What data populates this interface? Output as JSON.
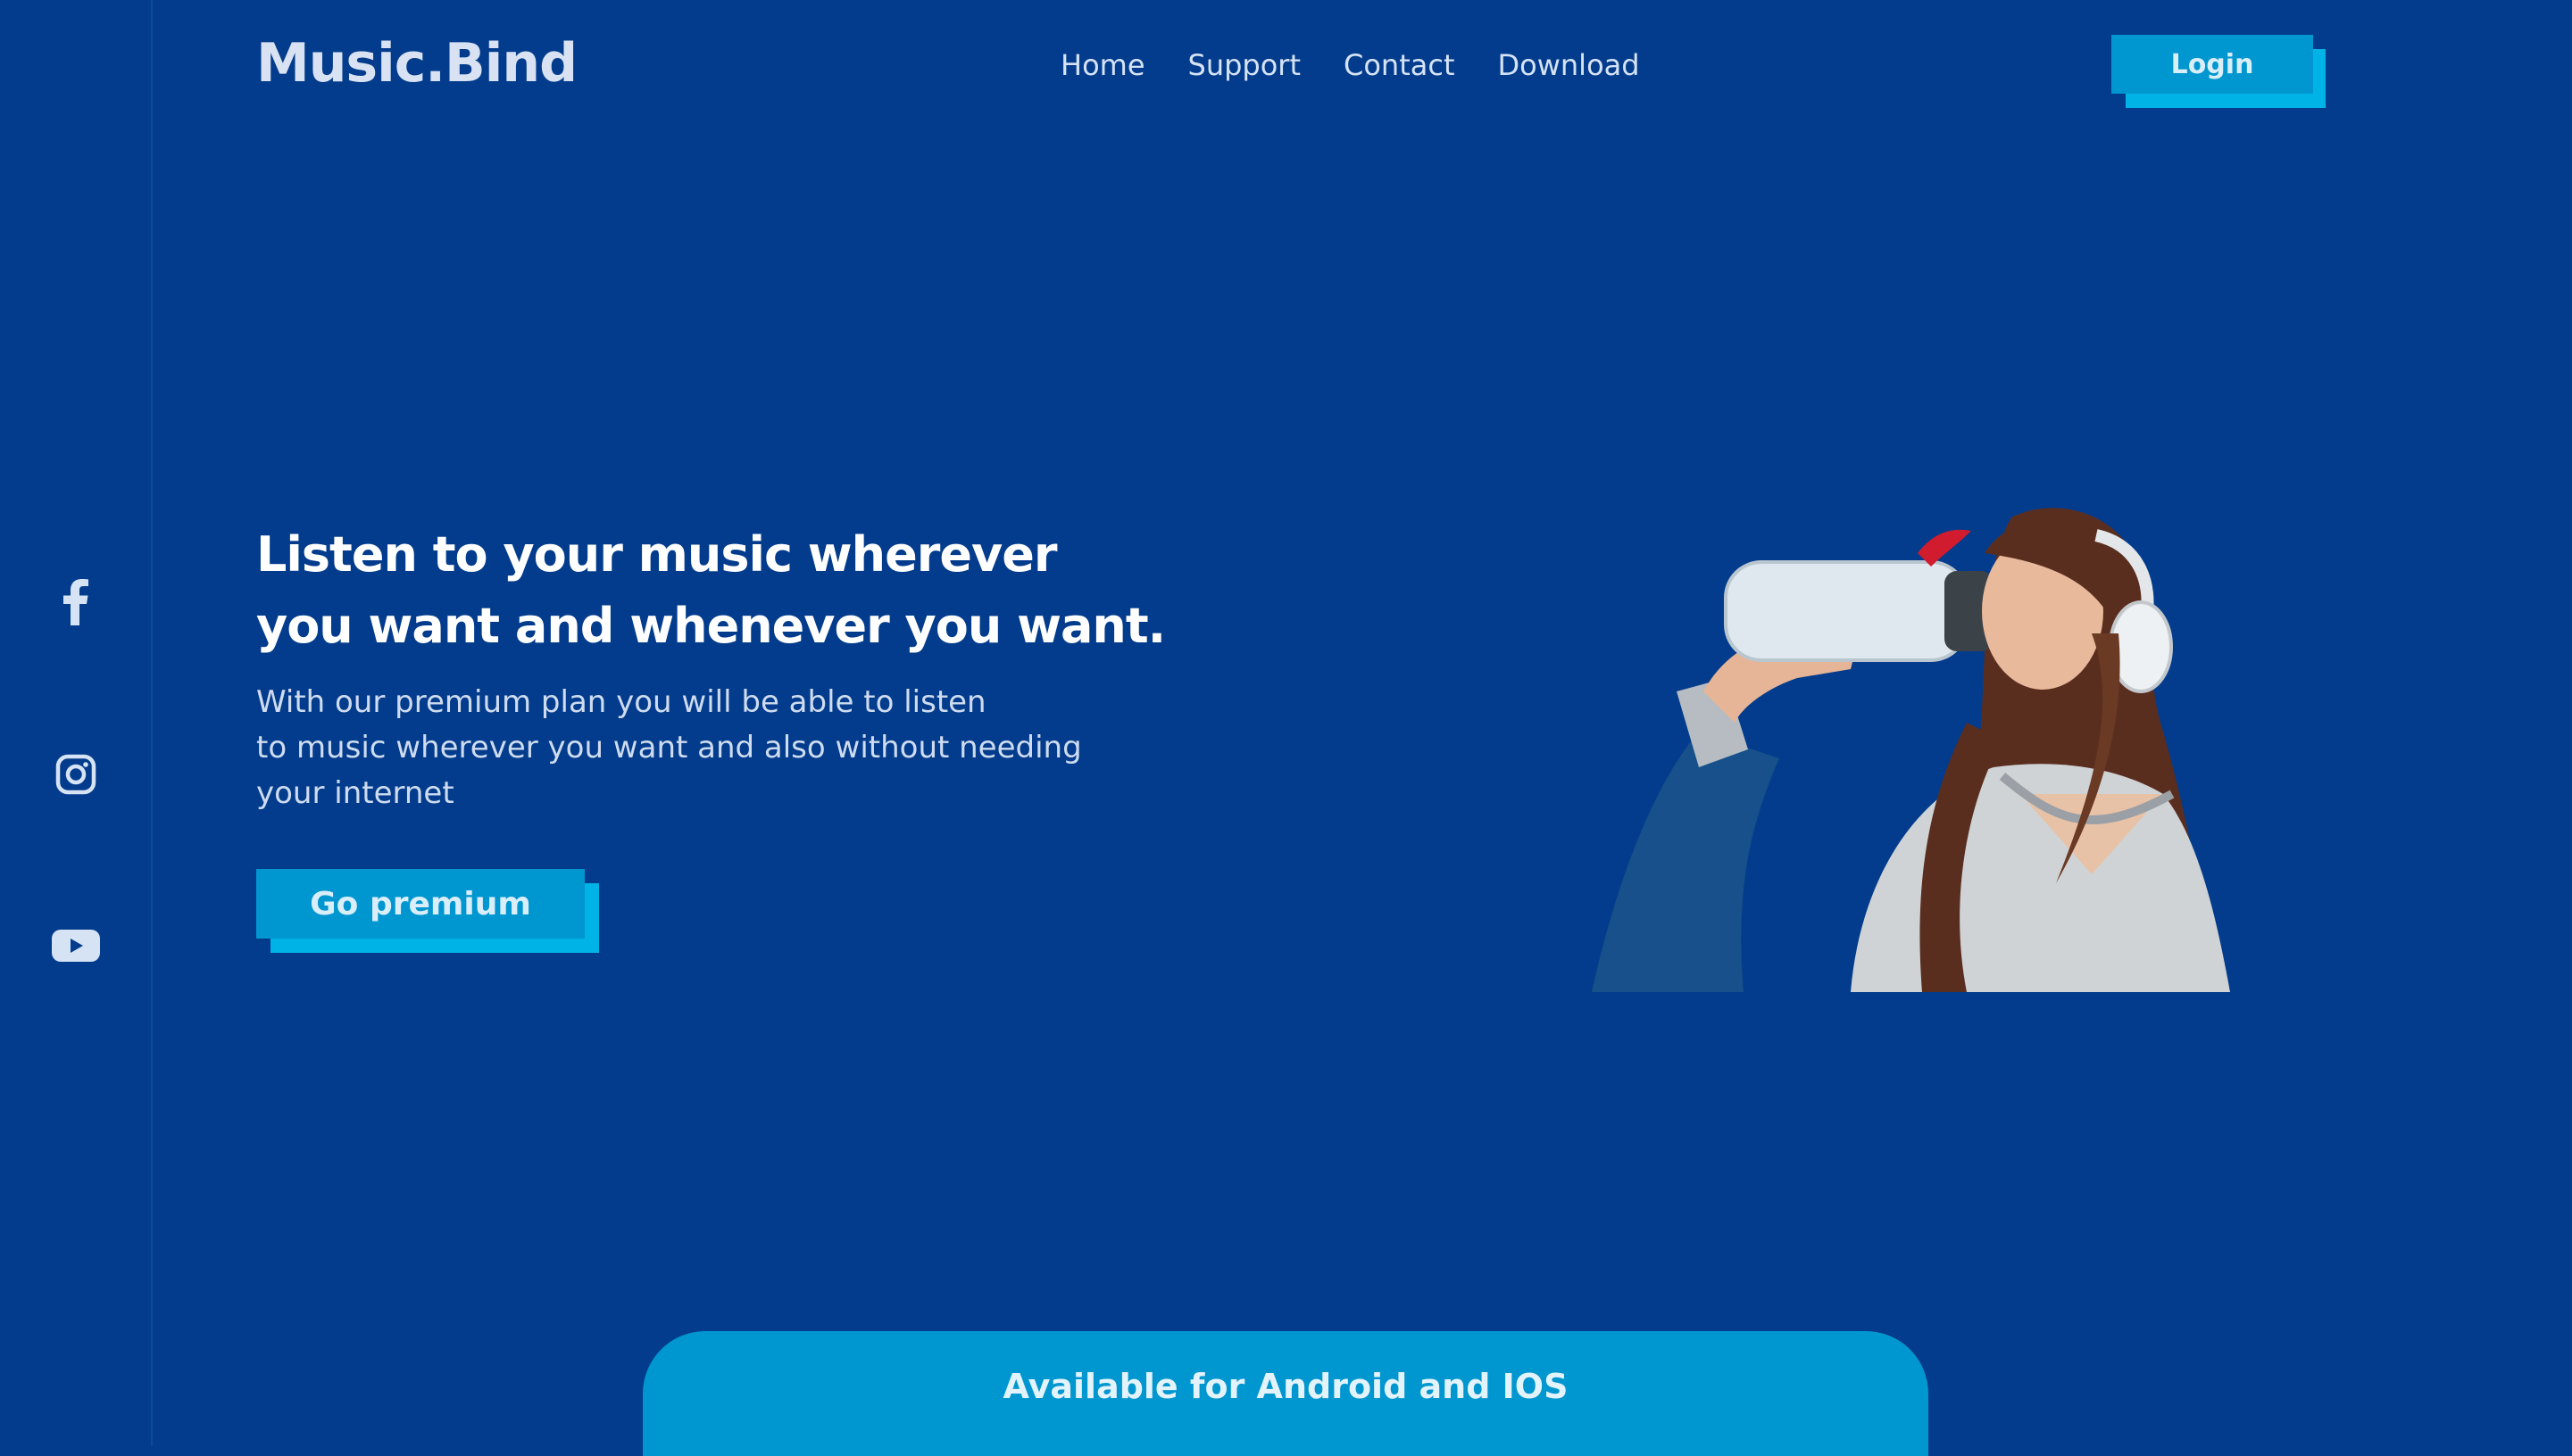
{
  "brand": {
    "logo": "Music.Bind"
  },
  "nav": {
    "items": [
      "Home",
      "Support",
      "Contact",
      "Download"
    ]
  },
  "header": {
    "login_label": "Login"
  },
  "hero": {
    "title_line1": "Listen to your music wherever",
    "title_line2": "you want and whenever you want.",
    "description_line1": "With our premium plan you will be able to listen",
    "description_line2": "to music wherever you want and also without needing",
    "description_line3": "your internet",
    "cta_label": "Go premium"
  },
  "social": {
    "icons": [
      "facebook-icon",
      "instagram-icon",
      "youtube-icon"
    ]
  },
  "banner": {
    "text": "Available for Android and IOS"
  },
  "colors": {
    "background": "#033c8c",
    "accent": "#0096cf",
    "accent_shadow": "#00b3e6"
  }
}
